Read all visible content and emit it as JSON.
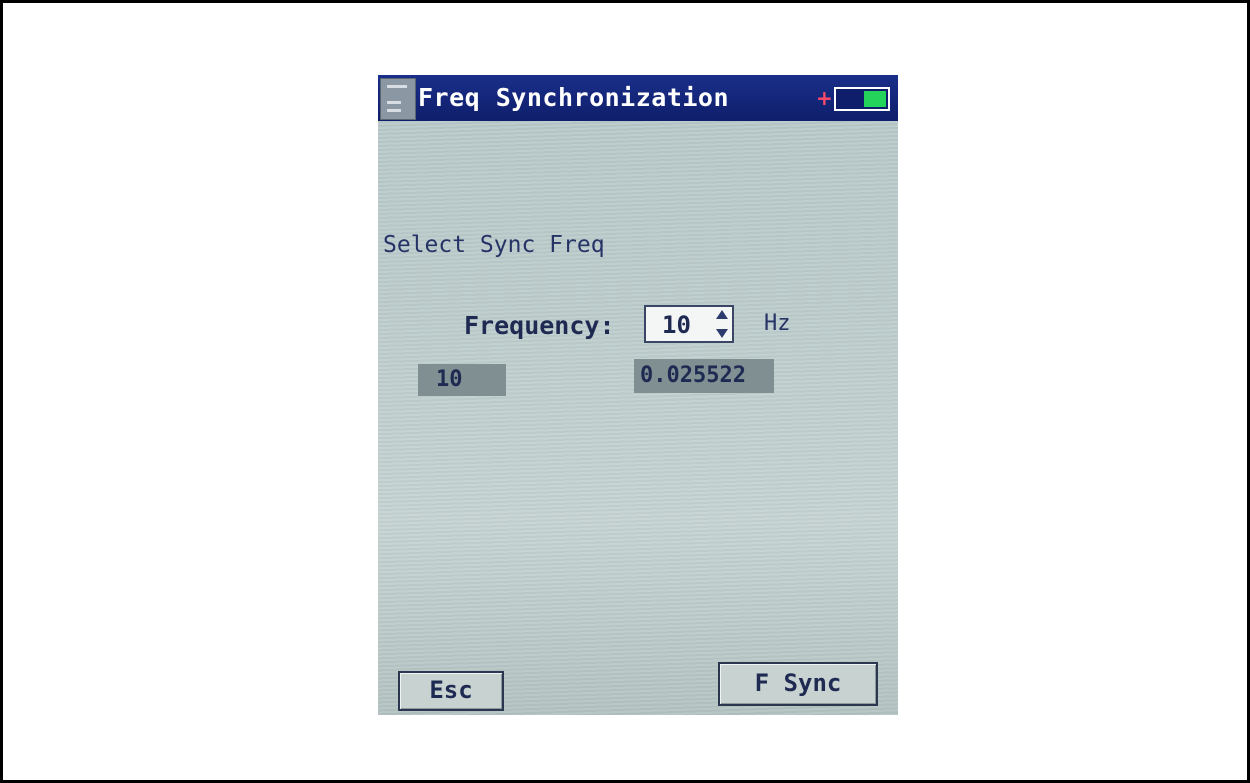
{
  "window": {
    "title": "Freq Synchronization",
    "app_icon": "sd-card-icon",
    "status_indicator": "+",
    "battery_level": 0.45
  },
  "main": {
    "prompt": "Select Sync Freq",
    "frequency_label": "Frequency:",
    "frequency_value": "10",
    "frequency_unit": "Hz",
    "readout_frequency": "10",
    "readout_value": "0.025522"
  },
  "buttons": {
    "esc_label": "Esc",
    "sync_label": "F Sync"
  },
  "colors": {
    "titlebar": "#0f1e6b",
    "screen_background": "#bdcccc",
    "readout_background": "#7f8f92",
    "battery_fill": "#23d35a",
    "status_plus": "#ff4a6a"
  }
}
